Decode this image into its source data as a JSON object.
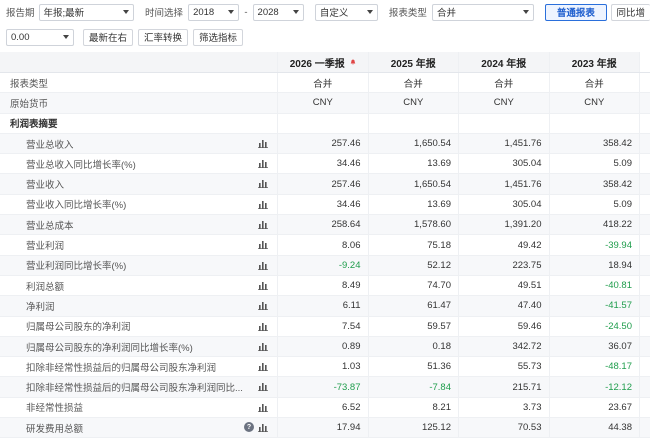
{
  "filters": {
    "report_period_label": "报告期",
    "report_period_value": "年报;最新",
    "time_select_label": "时间选择",
    "year_from": "2018",
    "range_separator": "-",
    "year_to": "2028",
    "custom_value": "自定义",
    "report_type_label": "报表类型",
    "report_type_value": "合并",
    "normal_report_button": "普通报表",
    "yoy_button_partial": "同比增"
  },
  "actions": {
    "decimal_value": "0.00",
    "newest_first_button": "最新在右",
    "exchange_button": "汇率转换",
    "filter_indicator_button": "筛选指标"
  },
  "table": {
    "columns": [
      "2026 一季报",
      "2025 年报",
      "2024 年报",
      "2023 年报"
    ],
    "rows": [
      {
        "name": "报表类型",
        "values": [
          "合并",
          "合并",
          "合并",
          "合并"
        ],
        "level": 0,
        "center": true
      },
      {
        "name": "原始货币",
        "values": [
          "CNY",
          "CNY",
          "CNY",
          "CNY"
        ],
        "level": 0,
        "center": true
      },
      {
        "name": "利润表摘要",
        "values": [
          "",
          "",
          "",
          ""
        ],
        "level": 0,
        "bold": true
      },
      {
        "name": "营业总收入",
        "values": [
          "257.46",
          "1,650.54",
          "1,451.76",
          "358.42"
        ],
        "level": 1,
        "chart": true
      },
      {
        "name": "营业总收入同比增长率(%)",
        "values": [
          "34.46",
          "13.69",
          "305.04",
          "5.09"
        ],
        "level": 1,
        "chart": true
      },
      {
        "name": "营业收入",
        "values": [
          "257.46",
          "1,650.54",
          "1,451.76",
          "358.42"
        ],
        "level": 1,
        "chart": true
      },
      {
        "name": "营业收入同比增长率(%)",
        "values": [
          "34.46",
          "13.69",
          "305.04",
          "5.09"
        ],
        "level": 1,
        "chart": true
      },
      {
        "name": "营业总成本",
        "values": [
          "258.64",
          "1,578.60",
          "1,391.20",
          "418.22"
        ],
        "level": 1,
        "chart": true
      },
      {
        "name": "营业利润",
        "values": [
          "8.06",
          "75.18",
          "49.42",
          "-39.94"
        ],
        "level": 1,
        "chart": true
      },
      {
        "name": "营业利润同比增长率(%)",
        "values": [
          "-9.24",
          "52.12",
          "223.75",
          "18.94"
        ],
        "level": 1,
        "chart": true
      },
      {
        "name": "利润总额",
        "values": [
          "8.49",
          "74.70",
          "49.51",
          "-40.81"
        ],
        "level": 1,
        "chart": true
      },
      {
        "name": "净利润",
        "values": [
          "6.11",
          "61.47",
          "47.40",
          "-41.57"
        ],
        "level": 1,
        "chart": true
      },
      {
        "name": "归属母公司股东的净利润",
        "values": [
          "7.54",
          "59.57",
          "59.46",
          "-24.50"
        ],
        "level": 1,
        "chart": true
      },
      {
        "name": "归属母公司股东的净利润同比增长率(%)",
        "values": [
          "0.89",
          "0.18",
          "342.72",
          "36.07"
        ],
        "level": 1,
        "chart": true
      },
      {
        "name": "扣除非经常性损益后的归属母公司股东净利润",
        "values": [
          "1.03",
          "51.36",
          "55.73",
          "-48.17"
        ],
        "level": 1,
        "chart": true
      },
      {
        "name": "扣除非经常性损益后的归属母公司股东净利润同比...",
        "values": [
          "-73.87",
          "-7.84",
          "215.71",
          "-12.12"
        ],
        "level": 1,
        "chart": true
      },
      {
        "name": "非经常性损益",
        "values": [
          "6.52",
          "8.21",
          "3.73",
          "23.67"
        ],
        "level": 1,
        "chart": true
      },
      {
        "name": "研发费用总额",
        "values": [
          "17.94",
          "125.12",
          "70.53",
          "44.38"
        ],
        "level": 1,
        "chart": true,
        "help": true
      }
    ]
  },
  "colors": {
    "negative": "#1f9d4c",
    "accent": "#2a6fdb",
    "bell": "#e04646"
  },
  "icons": {
    "chart": "bar-chart-icon",
    "help": "question-icon",
    "bell": "bell-icon",
    "dropdown": "chevron-down-icon"
  }
}
